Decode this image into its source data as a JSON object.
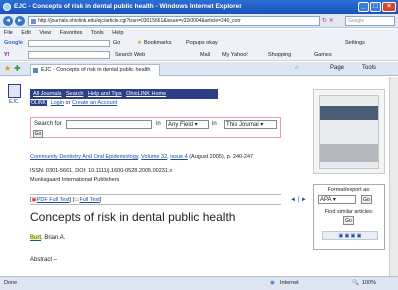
{
  "window": {
    "title": "EJC - Concepts of risk in dental public health - Windows Internet Explorer"
  },
  "address": {
    "url": "http://journals.ohiolink.edu/ejc/article.cgi?issn=03015661&issue=v32i0004&article=240_corr",
    "search_placeholder": "Google"
  },
  "menu": [
    "File",
    "Edit",
    "View",
    "Favorites",
    "Tools",
    "Help"
  ],
  "google_bar": {
    "label": "Google",
    "go": "Go",
    "bookmarks": "Bookmarks",
    "popups": "Popups okay",
    "settings": "Settings"
  },
  "yahoo_bar": {
    "search_web": "Search Web",
    "mail": "Mail",
    "my_yahoo": "My Yahoo!",
    "shopping": "Shopping",
    "games": "Games"
  },
  "tab": {
    "label": "EJC - Concepts of risk in dental public health",
    "page_menu": "Page",
    "tools_menu": "Tools"
  },
  "sidebar": {
    "ejc_label": "EJC"
  },
  "toolbar_links": [
    "All Journals",
    "Search",
    "Help and Tips",
    "OhioLINK Home"
  ],
  "login": {
    "badge": "OLINK",
    "login": "Login",
    "or": "or",
    "create": "Create an Account"
  },
  "search": {
    "label": "Search for",
    "in": "in",
    "field": "Any Field",
    "in2": "in",
    "scope": "This Journal",
    "go": "Go"
  },
  "citation": {
    "journal": "Community Dentistry And Oral Epidemiology",
    "volume": "Volume 32",
    "issue": "issue 4",
    "rest": "(August 2005), p. 240-247"
  },
  "issn_line": "ISSN: 0301-5661, DOI: 10.1111/j.1600-0528.2005.00231.x",
  "publisher": "Munksgaard International Publishers",
  "fulltext": {
    "pdf": "PDF Full Text",
    "txt": "Full Text",
    "arrows": "◄ | ►"
  },
  "article": {
    "title": "Concepts of risk in dental public health",
    "author_hl": "Burt",
    "author_rest": ", Brian A.",
    "abstract": "Abstract –"
  },
  "export": {
    "title": "Format/export as:",
    "format": "APA",
    "go": "Go",
    "similar": "Find similar articles:",
    "similar_go": "Go"
  },
  "status": {
    "left": "Done",
    "zone": "Internet",
    "zoom": "100%"
  }
}
